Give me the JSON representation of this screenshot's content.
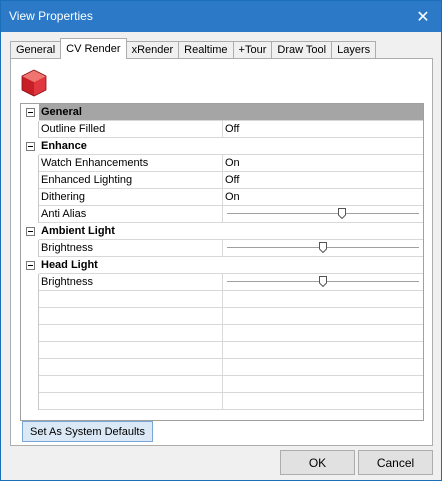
{
  "window": {
    "title": "View Properties"
  },
  "tabs": [
    {
      "label": "General",
      "active": false
    },
    {
      "label": "CV Render",
      "active": true
    },
    {
      "label": "xRender",
      "active": false
    },
    {
      "label": "Realtime",
      "active": false
    },
    {
      "label": "+Tour",
      "active": false
    },
    {
      "label": "Draw Tool",
      "active": false
    },
    {
      "label": "Layers",
      "active": false
    }
  ],
  "icons": {
    "cube": "red-cube-icon",
    "close": "close-icon",
    "expander": "collapse-minus-icon",
    "thumb": "slider-thumb-icon"
  },
  "colors": {
    "titlebar": "#2c7ac7",
    "selected_category": "#a5a5a5",
    "cube": "#d9272e"
  },
  "grid": {
    "categories": [
      {
        "label": "General",
        "selected": true,
        "props": [
          {
            "name": "Outline Filled",
            "value": "Off"
          }
        ]
      },
      {
        "label": "Enhance",
        "selected": false,
        "props": [
          {
            "name": "Watch Enhancements",
            "value": "On"
          },
          {
            "name": "Enhanced Lighting",
            "value": "Off"
          },
          {
            "name": "Dithering",
            "value": "On"
          },
          {
            "name": "Anti Alias",
            "slider": 0.6
          }
        ]
      },
      {
        "label": "Ambient Light",
        "selected": false,
        "props": [
          {
            "name": "Brightness",
            "slider": 0.5
          }
        ]
      },
      {
        "label": "Head Light",
        "selected": false,
        "props": [
          {
            "name": "Brightness",
            "slider": 0.5
          }
        ]
      }
    ]
  },
  "buttons": {
    "defaults": "Set As System Defaults",
    "ok": "OK",
    "cancel": "Cancel"
  }
}
